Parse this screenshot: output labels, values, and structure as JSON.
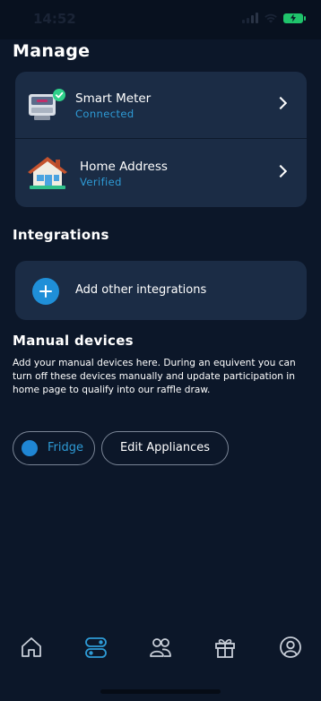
{
  "status_bar": {
    "time": "14:52"
  },
  "page": {
    "title": "Manage"
  },
  "manage": {
    "items": [
      {
        "title": "Smart Meter",
        "status": "Connected",
        "icon": "smart-meter-icon"
      },
      {
        "title": "Home Address",
        "status": "Verified",
        "icon": "house-icon"
      }
    ]
  },
  "integrations": {
    "heading": "Integrations",
    "add_label": "Add other integrations"
  },
  "manual_devices": {
    "heading": "Manual devices",
    "description": "Add your manual devices here. During an equivent you can turn off these devices manually and update participation in home page to qualify into our raffle draw.",
    "device_label": "Fridge",
    "edit_label": "Edit Appliances"
  },
  "tab_bar": {
    "tabs": [
      "home-icon",
      "devices-icon",
      "community-icon",
      "rewards-icon",
      "profile-icon"
    ],
    "active": "devices-icon"
  },
  "colors": {
    "background": "#0c1729",
    "card": "#1b2c45",
    "accent": "#2e9bd6",
    "success": "#2fd08a"
  }
}
